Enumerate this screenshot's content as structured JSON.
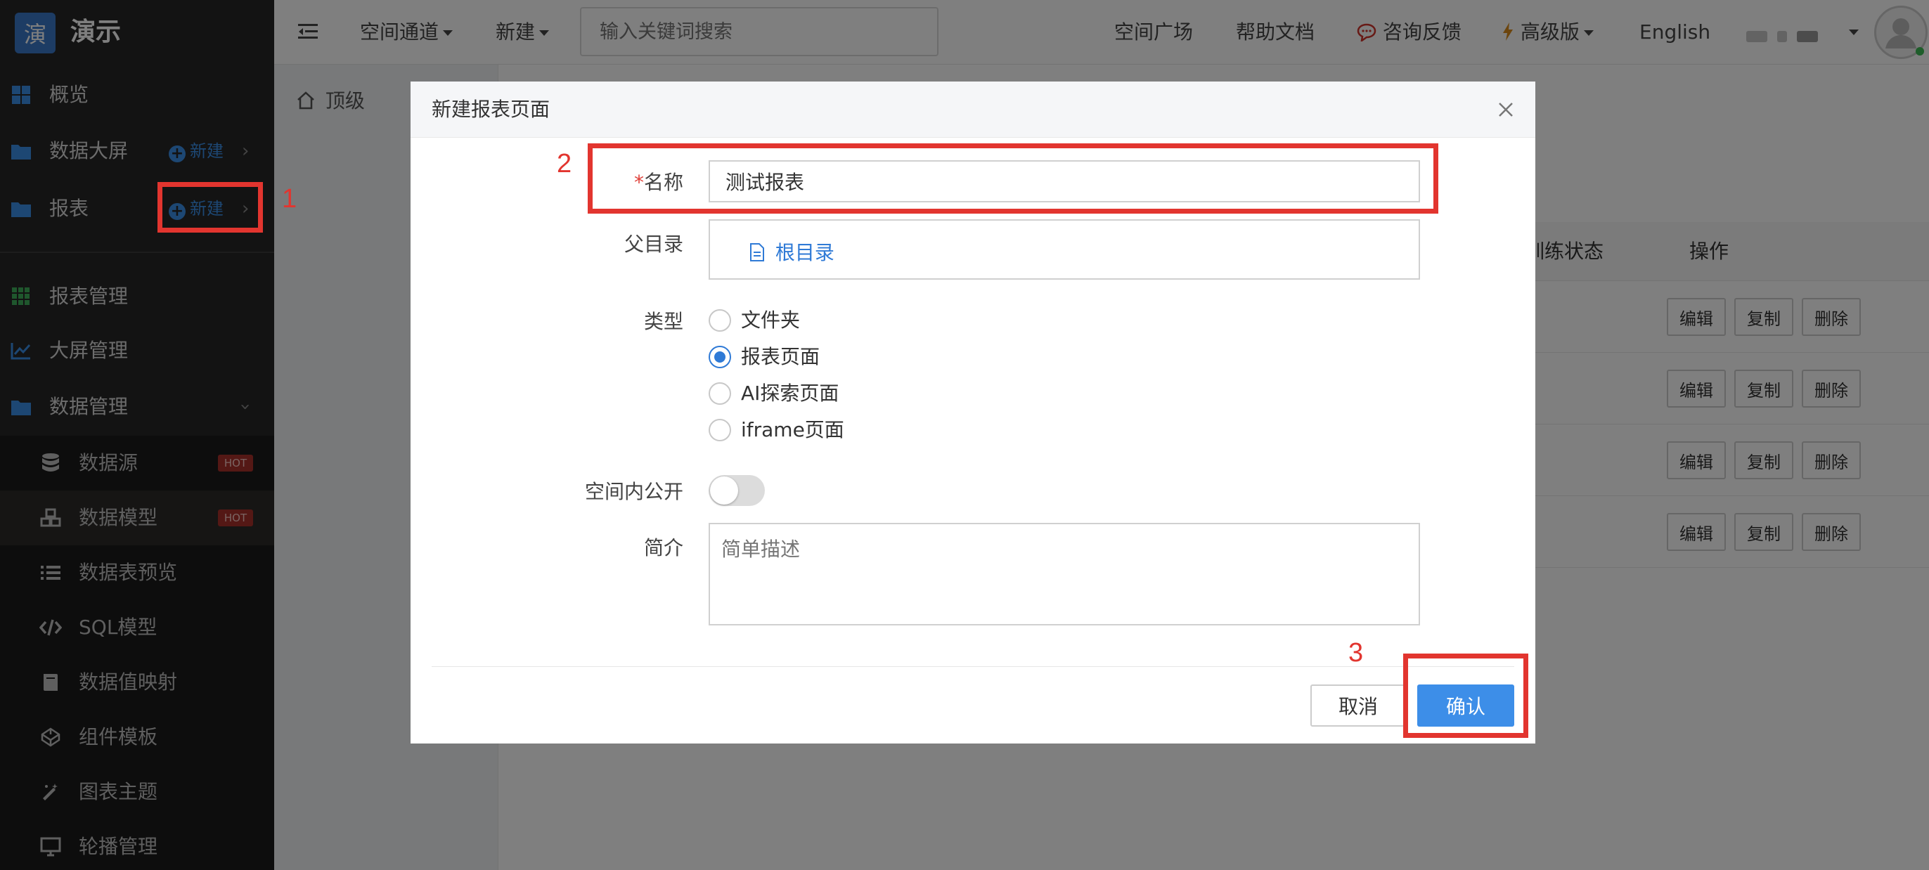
{
  "app": {
    "logo_char": "演",
    "name": "演示"
  },
  "sidebar": {
    "overview": "概览",
    "screens": {
      "label": "数据大屏",
      "new_label": "新建"
    },
    "reports": {
      "label": "报表",
      "new_label": "新建"
    },
    "report_manage": "报表管理",
    "screen_manage": "大屏管理",
    "data_manage": "数据管理",
    "sub_items": [
      {
        "label": "数据源",
        "badge": "HOT",
        "icon": "database-icon"
      },
      {
        "label": "数据模型",
        "badge": "HOT",
        "icon": "cubes-icon"
      },
      {
        "label": "数据表预览",
        "icon": "list-icon"
      },
      {
        "label": "SQL模型",
        "icon": "code-icon"
      },
      {
        "label": "数据值映射",
        "icon": "book-icon"
      },
      {
        "label": "组件模板",
        "icon": "codepen-icon"
      },
      {
        "label": "图表主题",
        "icon": "magic-wand-icon"
      },
      {
        "label": "轮播管理",
        "icon": "monitor-icon"
      }
    ]
  },
  "topbar": {
    "space_channel": "空间通道",
    "new": "新建",
    "search_placeholder": "输入关键词搜索",
    "space_square": "空间广场",
    "help_docs": "帮助文档",
    "feedback": "咨询反馈",
    "advanced": "高级版",
    "language": "English"
  },
  "content": {
    "breadcrumb": "顶级",
    "col_train_status": "训练状态",
    "col_actions": "操作",
    "row_actions": [
      "编辑",
      "复制",
      "删除"
    ],
    "row_count": 4
  },
  "modal": {
    "title": "新建报表页面",
    "name_label": "名称",
    "name_value": "测试报表",
    "parent_label": "父目录",
    "parent_value": "根目录",
    "type_label": "类型",
    "types": [
      {
        "label": "文件夹",
        "selected": false
      },
      {
        "label": "报表页面",
        "selected": true
      },
      {
        "label": "AI探索页面",
        "selected": false
      },
      {
        "label": "iframe页面",
        "selected": false
      }
    ],
    "public_label": "空间内公开",
    "public_on": false,
    "desc_label": "简介",
    "desc_placeholder": "简单描述",
    "cancel": "取消",
    "confirm": "确认"
  },
  "annotations": [
    "1",
    "2",
    "3"
  ],
  "colors": {
    "accent": "#3d8ee8",
    "annotation": "#e2352f",
    "sidebar": "#262626"
  }
}
